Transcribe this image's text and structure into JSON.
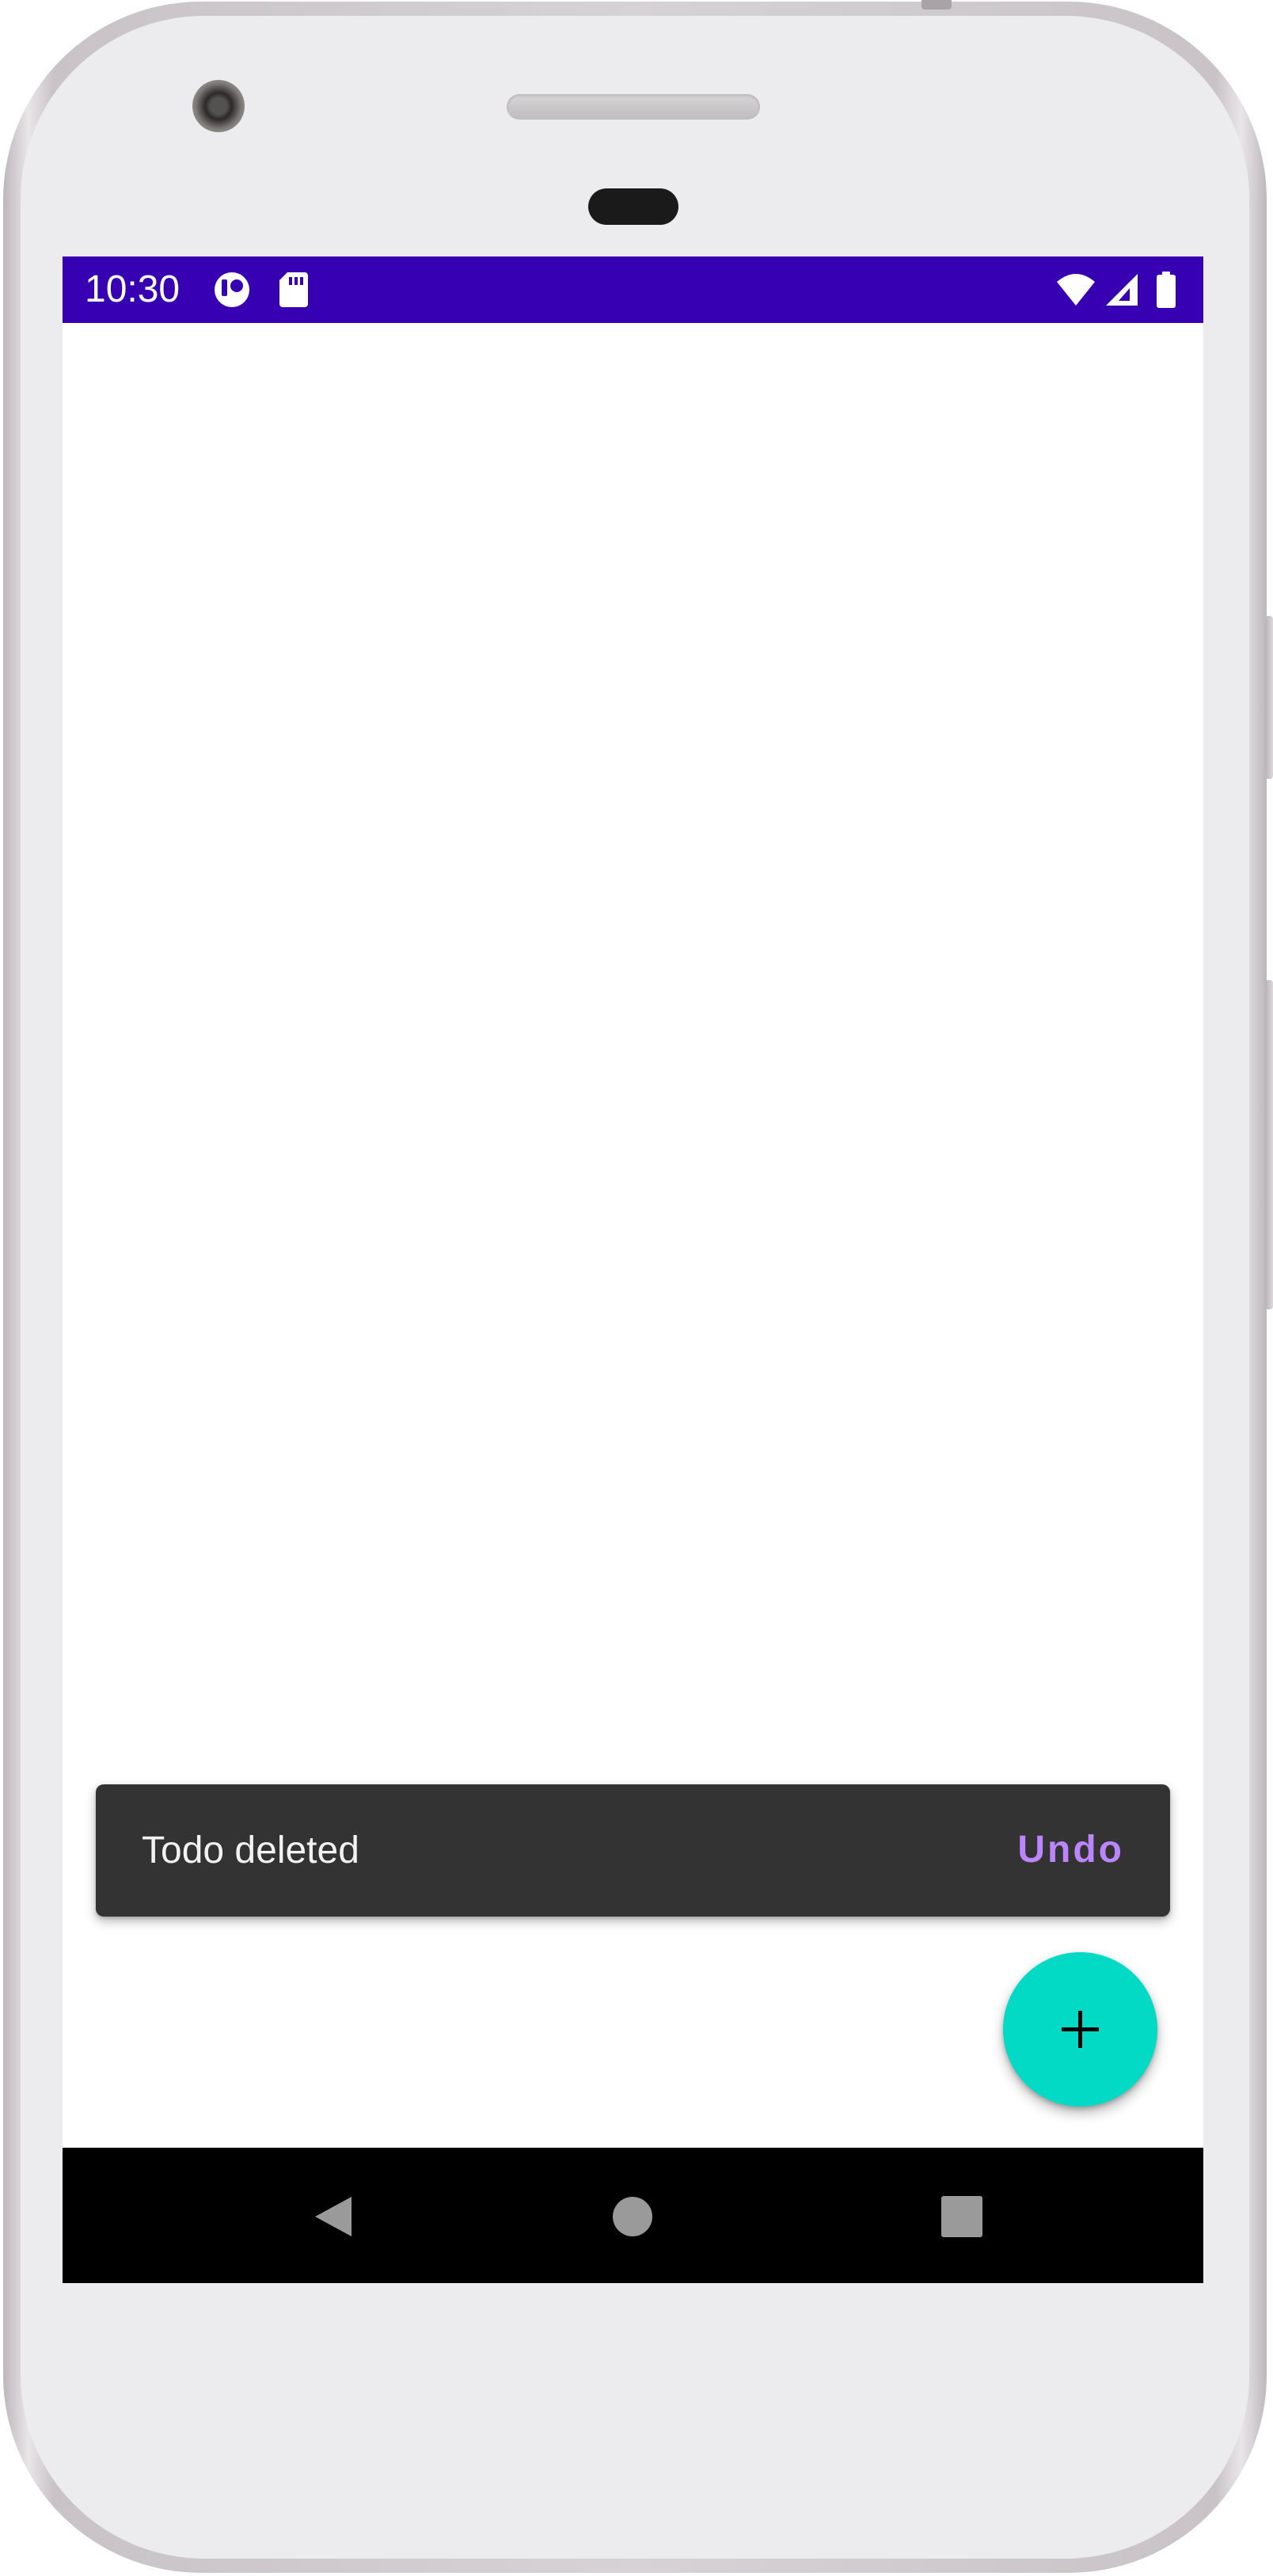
{
  "status_bar": {
    "time": "10:30",
    "background_color": "#3700b3",
    "left_icons": [
      "media-playback-icon",
      "sd-card-icon"
    ],
    "right_icons": [
      "wifi-icon",
      "cellular-signal-icon",
      "battery-icon"
    ]
  },
  "snackbar": {
    "message": "Todo deleted",
    "action_label": "Undo",
    "background_color": "#333333",
    "action_color": "#bb86fc"
  },
  "fab": {
    "icon": "add-icon",
    "color": "#03dac5"
  },
  "navigation_bar": {
    "buttons": [
      "back-icon",
      "home-icon",
      "recents-icon"
    ]
  }
}
